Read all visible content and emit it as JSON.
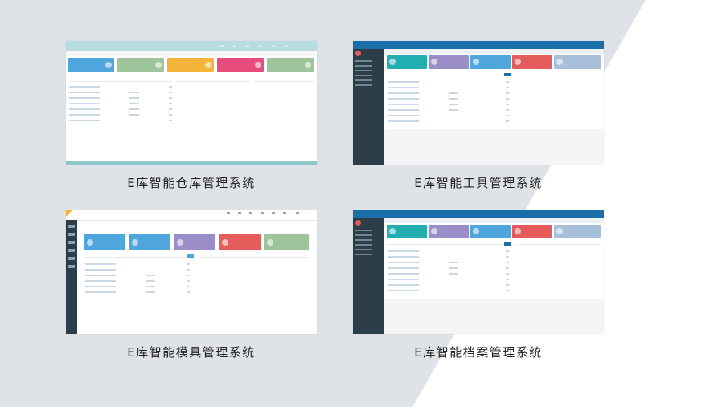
{
  "captions": [
    "E库智能仓库管理系统",
    "E库智能工具管理系统",
    "E库智能模具管理系统",
    "E库智能档案管理系统"
  ],
  "colors": {
    "teal": "#22aeb0",
    "purple": "#9b8ec8",
    "blue": "#4fa6dc",
    "red": "#e65b5b",
    "green": "#9ec49b",
    "yellow": "#f5b53b",
    "pink": "#e64d7d",
    "sidebar": "#2c3e4a",
    "topbar_tool": "#1b6fa8",
    "topbar_wh": "#b8dde0",
    "background_grey": "#dfe3e7"
  }
}
